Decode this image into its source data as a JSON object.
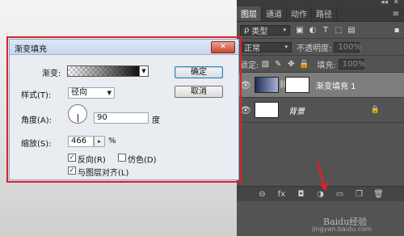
{
  "dialog": {
    "title": "渐变填充",
    "close_glyph": "✕",
    "gradient_label": "渐变:",
    "style_label": "样式(T):",
    "style_value": "径向",
    "angle_label": "角度(A):",
    "angle_value": "90",
    "angle_unit": "度",
    "scale_label": "缩放(S):",
    "scale_value": "466",
    "scale_unit": "%",
    "reverse_label": "反向(R)",
    "reverse_checked": "✓",
    "dither_label": "仿色(D)",
    "align_label": "与图层对齐(L)",
    "align_checked": "✓",
    "ok_label": "确定",
    "cancel_label": "取消"
  },
  "panel": {
    "tabs": [
      "图层",
      "通道",
      "动作",
      "路径"
    ],
    "top_dbl": "◂◂",
    "top_close": "✕",
    "menu_glyph": "≡",
    "filter_icon": "ρ",
    "filter_label": "类型",
    "blend_mode": "正常",
    "opacity_label": "不透明度:",
    "opacity_value": "100%",
    "lock_label": "锁定:",
    "fill_label": "填充:",
    "fill_value": "100%",
    "layers": [
      {
        "name": "渐变填充 1",
        "selected": true
      },
      {
        "name": "背景",
        "selected": false
      }
    ],
    "bottom_icons": [
      "⊖",
      "fx",
      "◘",
      "◑",
      "▭",
      "❐",
      "🗑"
    ]
  },
  "watermark": {
    "logo": "Baidu经验",
    "url": "jingyan.baidu.com"
  },
  "colors": {
    "highlight": "#d8232a",
    "panel": "#535353"
  }
}
